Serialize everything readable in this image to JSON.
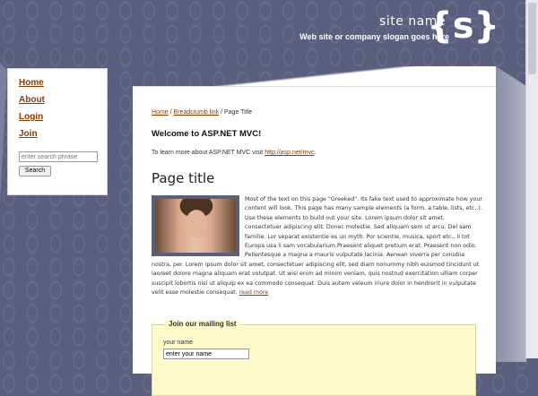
{
  "header": {
    "site_name": "site name",
    "slogan": "Web site or company slogan goes here",
    "logo": "{s}"
  },
  "nav": {
    "items": [
      {
        "label": "Home"
      },
      {
        "label": "About"
      },
      {
        "label": "Login"
      },
      {
        "label": "Join"
      }
    ],
    "search_placeholder": "enter search phrase",
    "search_button": "Search"
  },
  "breadcrumb": {
    "home": "Home",
    "link": "Breadcrumb link",
    "current": "Page Title",
    "separator": "/"
  },
  "main": {
    "welcome": "Welcome to ASP.NET MVC!",
    "learn_prefix": "To learn more about ASP.NET MVC visit",
    "learn_link": "http://asp.net/mvc",
    "learn_suffix": ".",
    "page_title": "Page title",
    "body_text": "Most of the text on this page \"Greeked\". Its fake text used to approximate how your content will look. This page has many sample elements (a form, a table, lists, etc..). Use these elements to build out your site. Lorem ipsum dolor sit amet, consectetuer adipiscing elit. Donec molestie. Sed aliquam sem ut arcu. Del sam familie. Lor separat existentie es un myth. Por scientie, musica, sport etc., li tot Europa usa li sam vocabularium.Praesent aliquet pretium erat. Praesent non odio. Pellentesque a magna a mauris vulputate lacinia. Aenean viverra per conubia nostra, per. Lorem ipsum dolor sit amet, consectetuer adipiscing elit, sed diam nonummy nibh euismod tincidunt ut laoreet dolore magna aliquam erat volutpat. Ut wisi enim ad minim veniam, quis nostrud exercitation ulliam corper suscipit lobortis nisl ut aliquip ex ea commodo consequat. Duis autem veleum iriure dolor in hendrerit in vulputate velit esse molestie consequat.",
    "read_more": "read more"
  },
  "mailing_list": {
    "legend": "Join our mailing list",
    "name_label": "your name",
    "name_value": "enter your name"
  },
  "colors": {
    "background": "#5a5f7d",
    "link": "#8b3b00",
    "fieldset_bg": "#fdfbcc"
  }
}
